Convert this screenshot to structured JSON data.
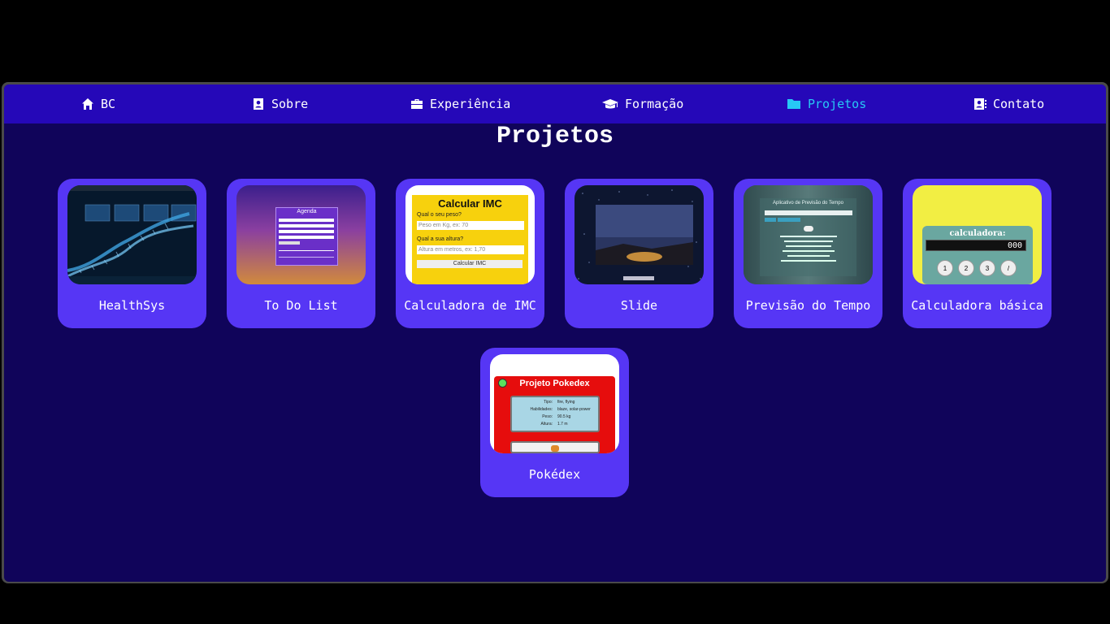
{
  "nav": {
    "items": [
      {
        "label": "BC",
        "icon": "home-icon"
      },
      {
        "label": "Sobre",
        "icon": "user-badge-icon"
      },
      {
        "label": "Experiência",
        "icon": "briefcase-icon"
      },
      {
        "label": "Formação",
        "icon": "graduation-cap-icon"
      },
      {
        "label": "Projetos",
        "icon": "folder-icon",
        "active": true
      },
      {
        "label": "Contato",
        "icon": "address-book-icon"
      }
    ]
  },
  "page": {
    "title": "Projetos"
  },
  "projects": [
    {
      "name": "HealthSys"
    },
    {
      "name": "To Do List",
      "thumb": {
        "title": "Agenda"
      }
    },
    {
      "name": "Calculadora de IMC",
      "thumb": {
        "title": "Calcular IMC",
        "weight_question": "Qual o seu peso?",
        "weight_placeholder": "Peso em Kg, ex: 70",
        "height_question": "Qual a sua altura?",
        "height_placeholder": "Altura em metros, ex: 1,70",
        "button": "Calcular IMC"
      }
    },
    {
      "name": "Slide"
    },
    {
      "name": "Previsão do Tempo",
      "thumb": {
        "title": "Aplicativo de Previsão do Tempo"
      }
    },
    {
      "name": "Calculadora básica",
      "thumb": {
        "title": "calculadora:",
        "display": "000",
        "keys": [
          "1",
          "2",
          "3",
          "/"
        ]
      }
    },
    {
      "name": "Pokédex",
      "thumb": {
        "title": "Projeto Pokedex",
        "rows": [
          [
            "Tipo:",
            "fire, flying"
          ],
          [
            "Habilidades:",
            "blaze, solar-power"
          ],
          [
            "Peso:",
            "90.5 kg"
          ],
          [
            "Altura:",
            "1.7 m"
          ]
        ]
      }
    }
  ],
  "colors": {
    "background": "#10045a",
    "navbar": "#2508b8",
    "card": "#5636f5",
    "active": "#27c8f5"
  }
}
